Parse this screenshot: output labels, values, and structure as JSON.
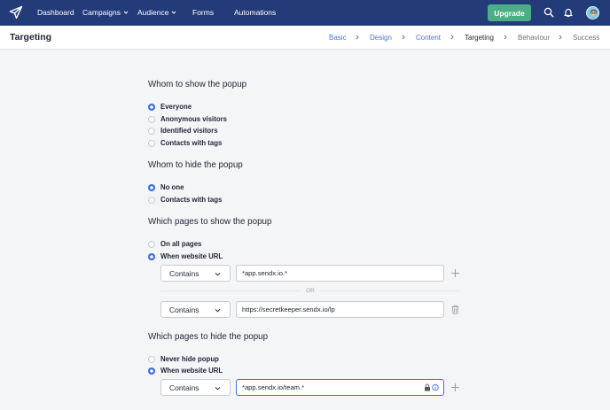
{
  "nav": {
    "items": [
      {
        "label": "Dashboard"
      },
      {
        "label": "Campaigns"
      },
      {
        "label": "Audience"
      },
      {
        "label": "Forms"
      },
      {
        "label": "Automations"
      }
    ],
    "upgrade_label": "Upgrade",
    "icons": [
      "paper-plane-logo-icon",
      "search-icon",
      "bell-icon",
      "avatar"
    ],
    "brand_color": "#243b7a",
    "upgrade_color": "#4cae85"
  },
  "header": {
    "title": "Targeting",
    "steps": [
      {
        "label": "Basic",
        "state": "done"
      },
      {
        "label": "Design",
        "state": "done"
      },
      {
        "label": "Content",
        "state": "done"
      },
      {
        "label": "Targeting",
        "state": "active"
      },
      {
        "label": "Behaviour",
        "state": "todo"
      },
      {
        "label": "Success",
        "state": "todo"
      }
    ]
  },
  "sections": {
    "show_to": {
      "title": "Whom to show the popup",
      "options": [
        {
          "label": "Everyone",
          "selected": true
        },
        {
          "label": "Anonymous visitors",
          "selected": false
        },
        {
          "label": "Identified visitors",
          "selected": false
        },
        {
          "label": "Contacts with tags",
          "selected": false
        }
      ]
    },
    "hide_from": {
      "title": "Whom to hide the popup",
      "options": [
        {
          "label": "No one",
          "selected": true
        },
        {
          "label": "Contacts with tags",
          "selected": false
        }
      ]
    },
    "show_pages": {
      "title": "Which pages to show the popup",
      "options": [
        {
          "label": "On all pages",
          "selected": false
        },
        {
          "label": "When website URL",
          "selected": true
        }
      ],
      "rules": [
        {
          "operator": "Contains",
          "value": "*app.sendx.io.*"
        },
        {
          "operator": "Contains",
          "value": "https://secretkeeper.sendx.io/lp"
        }
      ],
      "separator": "OR"
    },
    "hide_pages": {
      "title": "Which pages to hide the popup",
      "options": [
        {
          "label": "Never hide popup",
          "selected": false
        },
        {
          "label": "When website URL",
          "selected": true
        }
      ],
      "rules": [
        {
          "operator": "Contains",
          "value": "*app.sendx.io/team.*"
        }
      ]
    }
  },
  "accent_color": "#3f6fd8"
}
